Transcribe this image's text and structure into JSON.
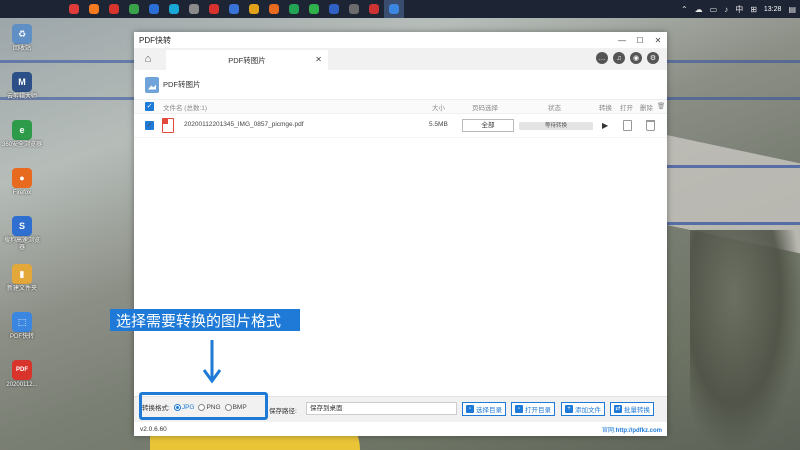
{
  "taskbar": {
    "apps": [
      {
        "name": "app-red",
        "color": "#e03b3b"
      },
      {
        "name": "app-orange",
        "color": "#f47b20"
      },
      {
        "name": "app-red2",
        "color": "#d6342c"
      },
      {
        "name": "app-green",
        "color": "#3aa34a"
      },
      {
        "name": "app-blue",
        "color": "#2b6fd6"
      },
      {
        "name": "app-cyan",
        "color": "#19a7d6"
      },
      {
        "name": "app-gray",
        "color": "#8b8b8b"
      },
      {
        "name": "app-red3",
        "color": "#d8322f"
      },
      {
        "name": "app-blue2",
        "color": "#3a73d8"
      },
      {
        "name": "app-chrome",
        "color": "#e2a21a"
      },
      {
        "name": "app-firefox",
        "color": "#e66a1f"
      },
      {
        "name": "app-green2",
        "color": "#23a455"
      },
      {
        "name": "app-wechat",
        "color": "#2fb24b"
      },
      {
        "name": "app-blue3",
        "color": "#2f62c4"
      },
      {
        "name": "app-gray2",
        "color": "#6c6c6c"
      },
      {
        "name": "app-red4",
        "color": "#cc3333"
      },
      {
        "name": "app-pdfkz",
        "color": "#3b86e0"
      }
    ],
    "time": "13:28",
    "ime": "中"
  },
  "desktop": {
    "icons": [
      {
        "label": "回收站",
        "color": "#5f8fc4",
        "glyph": "♻"
      },
      {
        "label": "云剪辑大师",
        "color": "#2b4f86",
        "glyph": "M"
      },
      {
        "label": "360安全浏览器",
        "color": "#2d9b4a",
        "glyph": "e"
      },
      {
        "label": "Firefox",
        "color": "#e86a1e",
        "glyph": "●"
      },
      {
        "label": "搜狗高速浏览器",
        "color": "#2f6fd0",
        "glyph": "S"
      },
      {
        "label": "新建文件夹",
        "color": "#e4a83a",
        "glyph": "▮"
      },
      {
        "label": "PDF快转",
        "color": "#3a86e0",
        "glyph": "⬚"
      },
      {
        "label": "20200112...",
        "color": "#d8342c",
        "glyph": "PDF"
      }
    ]
  },
  "window": {
    "title": "PDF快转",
    "controls": {
      "minimize": "—",
      "maximize": "☐",
      "close": "✕"
    }
  },
  "tabs": {
    "home_icon": "⌂",
    "active_tab": "PDF转图片",
    "close": "✕",
    "tools": [
      "…",
      "♫",
      "◉",
      "⚙"
    ]
  },
  "section": {
    "title": "PDF转图片"
  },
  "table": {
    "headers": {
      "filename": "文件名 (总数:1)",
      "size": "大小",
      "pages": "页码选择",
      "status": "状态",
      "convert": "转换",
      "open": "打开",
      "delete": "删除"
    },
    "rows": [
      {
        "filename": "20200112201345_IMG_0857_picmge.pdf",
        "size": "5.5MB",
        "pages": "全部",
        "status": "等待转换"
      }
    ]
  },
  "bottom": {
    "format_label": "转换格式:",
    "formats": [
      {
        "label": "JPG",
        "selected": true
      },
      {
        "label": "PNG",
        "selected": false
      },
      {
        "label": "BMP",
        "selected": false
      }
    ],
    "save_label": "保存路径:",
    "save_value": "保存到桌面",
    "buttons": {
      "choose_dir": "选择目录",
      "open_dir": "打开目录",
      "add_file": "添加文件",
      "batch": "批量转换"
    }
  },
  "footer": {
    "version": "v2.0.6.60",
    "website_label": "官网:",
    "website": "http://pdfkz.com"
  },
  "annotation": {
    "hint": "选择需要转换的图片格式"
  },
  "colors": {
    "accent": "#1e7ad6"
  }
}
